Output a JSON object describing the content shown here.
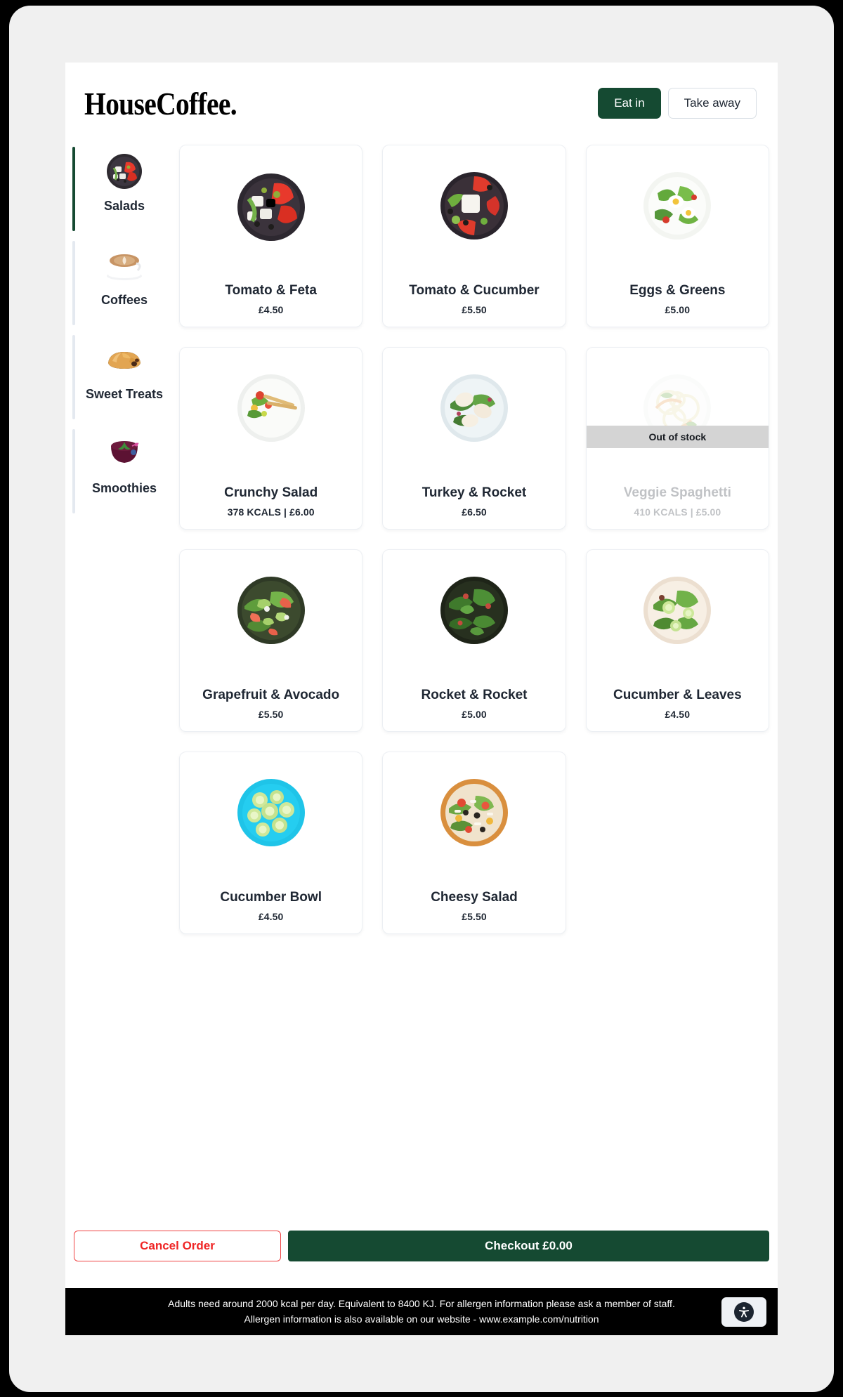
{
  "brand": {
    "logo": "HouseCoffee."
  },
  "order_mode": {
    "options": [
      {
        "label": "Eat in",
        "active": true
      },
      {
        "label": "Take away",
        "active": false
      }
    ]
  },
  "sidebar": {
    "items": [
      {
        "label": "Salads",
        "icon": "salad-plate-icon",
        "active": true
      },
      {
        "label": "Coffees",
        "icon": "latte-cup-icon",
        "active": false
      },
      {
        "label": "Sweet Treats",
        "icon": "pain-au-chocolat-icon",
        "active": false
      },
      {
        "label": "Smoothies",
        "icon": "berry-smoothie-icon",
        "active": false
      }
    ]
  },
  "menu": {
    "items": [
      {
        "title": "Tomato & Feta",
        "meta": "£4.50",
        "price": "£4.50",
        "kcals": null,
        "in_stock": true,
        "icon": "tomato-feta-plate-icon"
      },
      {
        "title": "Tomato & Cucumber",
        "meta": "£5.50",
        "price": "£5.50",
        "kcals": null,
        "in_stock": true,
        "icon": "tomato-cucumber-bowl-icon"
      },
      {
        "title": "Eggs & Greens",
        "meta": "£5.00",
        "price": "£5.00",
        "kcals": null,
        "in_stock": true,
        "icon": "eggs-greens-bowl-icon"
      },
      {
        "title": "Crunchy Salad",
        "meta": "378 KCALS | £6.00",
        "price": "£6.00",
        "kcals": "378 KCALS",
        "in_stock": true,
        "icon": "crunchy-salad-plate-icon"
      },
      {
        "title": "Turkey & Rocket",
        "meta": "£6.50",
        "price": "£6.50",
        "kcals": null,
        "in_stock": true,
        "icon": "turkey-rocket-plate-icon"
      },
      {
        "title": "Veggie Spaghetti",
        "meta": "410 KCALS | £5.00",
        "price": "£5.00",
        "kcals": "410 KCALS",
        "in_stock": false,
        "icon": "veggie-spaghetti-bowl-icon"
      },
      {
        "title": "Grapefruit & Avocado",
        "meta": "£5.50",
        "price": "£5.50",
        "kcals": null,
        "in_stock": true,
        "icon": "grapefruit-avocado-bowl-icon"
      },
      {
        "title": "Rocket & Rocket",
        "meta": "£5.00",
        "price": "£5.00",
        "kcals": null,
        "in_stock": true,
        "icon": "rocket-rocket-bowl-icon"
      },
      {
        "title": "Cucumber & Leaves",
        "meta": "£4.50",
        "price": "£4.50",
        "kcals": null,
        "in_stock": true,
        "icon": "cucumber-leaves-bowl-icon"
      },
      {
        "title": "Cucumber Bowl",
        "meta": "£4.50",
        "price": "£4.50",
        "kcals": null,
        "in_stock": true,
        "icon": "cucumber-bowl-icon"
      },
      {
        "title": "Cheesy Salad",
        "meta": "£5.50",
        "price": "£5.50",
        "kcals": null,
        "in_stock": true,
        "icon": "cheesy-salad-bowl-icon"
      }
    ],
    "out_of_stock_label": "Out of stock"
  },
  "actions": {
    "cancel_label": "Cancel Order",
    "checkout_label": "Checkout £0.00",
    "checkout_total": "£0.00"
  },
  "footer": {
    "line1": "Adults need around 2000 kcal per day. Equivalent to 8400 KJ. For allergen information please ask a member of staff.",
    "line2": "Allergen information is also available on our website - www.example.com/nutrition",
    "accessibility_icon": "accessibility-person-icon"
  },
  "colors": {
    "brand_green": "#154a32",
    "danger_red": "#ef2424",
    "out_of_stock_banner": "#d4d4d4",
    "text_dark": "#1f2733"
  }
}
